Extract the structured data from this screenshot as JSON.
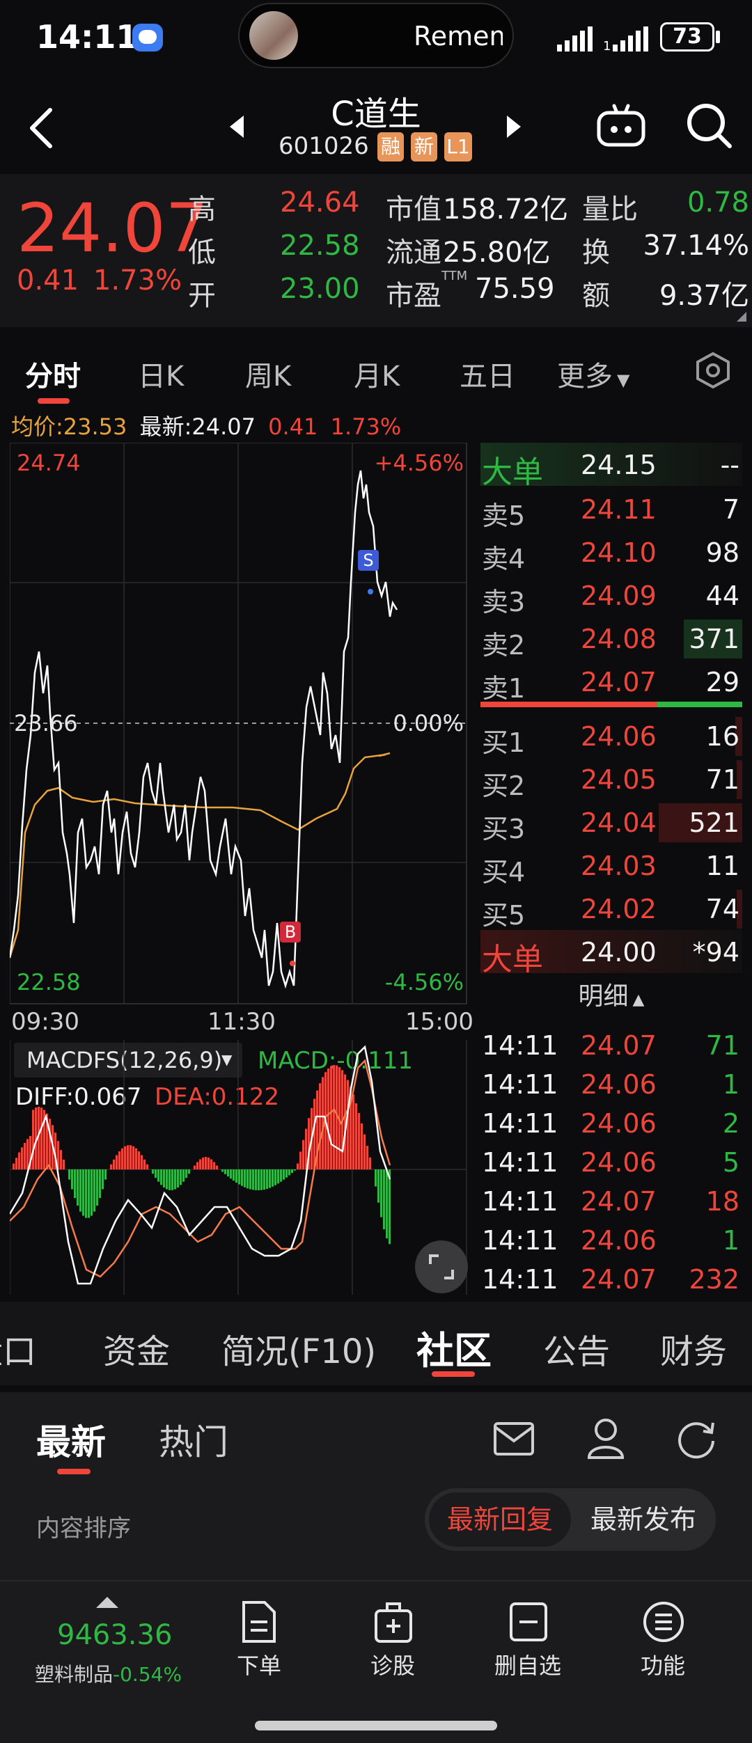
{
  "status_bar": {
    "time": "14:11",
    "notification_text": "Remem",
    "battery": "73"
  },
  "header": {
    "title": "C道生",
    "code": "601026",
    "badges": [
      "融",
      "新",
      "L1"
    ]
  },
  "quote": {
    "price": "24.07",
    "change": "0.41",
    "change_pct": "1.73%",
    "rows": [
      {
        "l1": "高",
        "v1": "24.64",
        "l2": "市值",
        "v2": "158.72亿",
        "l3": "量比",
        "v3": "0.78"
      },
      {
        "l1": "低",
        "v1": "22.58",
        "l2": "流通",
        "v2": "25.80亿",
        "l3": "换",
        "v3": "37.14%"
      },
      {
        "l1": "开",
        "v1": "23.00",
        "l2": "市盈",
        "l2sup": "TTM",
        "v2": "75.59",
        "l3": "额",
        "v3": "9.37亿"
      }
    ]
  },
  "ktabs": [
    "分时",
    "日K",
    "周K",
    "月K",
    "五日",
    "更多"
  ],
  "chart": {
    "avg_label": "均价:23.53",
    "latest_label": "最新:24.07",
    "latest_chg": "0.41",
    "latest_pct": "1.73%",
    "y_top": "24.74",
    "y_top_pct": "+4.56%",
    "y_mid": "23.66",
    "y_mid_pct": "0.00%",
    "y_bot": "22.58",
    "y_bot_pct": "-4.56%",
    "x_labels": [
      "09:30",
      "11:30",
      "15:00"
    ],
    "marker_s": "S",
    "marker_b": "B",
    "macd_title": "MACDFS(12,26,9)",
    "macd_val": "MACD:-0.111",
    "diff": "DIFF:0.067",
    "dea": "DEA:0.122",
    "colors": {
      "price": "#ffffff",
      "avg": "#e8a33b",
      "up": "#f0453a",
      "down": "#2fb944"
    }
  },
  "orderbook": {
    "big_sell": {
      "label": "大单",
      "price": "24.15",
      "vol": "--"
    },
    "asks": [
      {
        "label": "卖5",
        "price": "24.11",
        "vol": "7"
      },
      {
        "label": "卖4",
        "price": "24.10",
        "vol": "98"
      },
      {
        "label": "卖3",
        "price": "24.09",
        "vol": "44"
      },
      {
        "label": "卖2",
        "price": "24.08",
        "vol": "371"
      },
      {
        "label": "卖1",
        "price": "24.07",
        "vol": "29"
      }
    ],
    "bids": [
      {
        "label": "买1",
        "price": "24.06",
        "vol": "16"
      },
      {
        "label": "买2",
        "price": "24.05",
        "vol": "71"
      },
      {
        "label": "买3",
        "price": "24.04",
        "vol": "521"
      },
      {
        "label": "买4",
        "price": "24.03",
        "vol": "11"
      },
      {
        "label": "买5",
        "price": "24.02",
        "vol": "74"
      }
    ],
    "big_buy": {
      "label": "大单",
      "price": "24.00",
      "vol": "*94"
    },
    "detail_label": "明细",
    "trades": [
      {
        "t": "14:11",
        "p": "24.07",
        "v": "71",
        "side": "buy"
      },
      {
        "t": "14:11",
        "p": "24.06",
        "v": "1",
        "side": "buy"
      },
      {
        "t": "14:11",
        "p": "24.06",
        "v": "2",
        "side": "buy"
      },
      {
        "t": "14:11",
        "p": "24.06",
        "v": "5",
        "side": "buy"
      },
      {
        "t": "14:11",
        "p": "24.07",
        "v": "18",
        "side": "sell"
      },
      {
        "t": "14:11",
        "p": "24.06",
        "v": "1",
        "side": "buy"
      },
      {
        "t": "14:11",
        "p": "24.07",
        "v": "232",
        "side": "sell"
      }
    ]
  },
  "section_tabs": [
    "盘口",
    "资金",
    "简况(F10)",
    "社区",
    "公告",
    "财务"
  ],
  "community": {
    "tabs": [
      "最新",
      "热门"
    ],
    "sort_label": "内容排序",
    "sort_options": [
      "最新回复",
      "最新发布"
    ]
  },
  "bottom_bar": {
    "index_value": "9463.36",
    "index_name": "塑料制品",
    "index_chg": "-0.54%",
    "items": [
      "下单",
      "诊股",
      "删自选",
      "功能"
    ]
  }
}
